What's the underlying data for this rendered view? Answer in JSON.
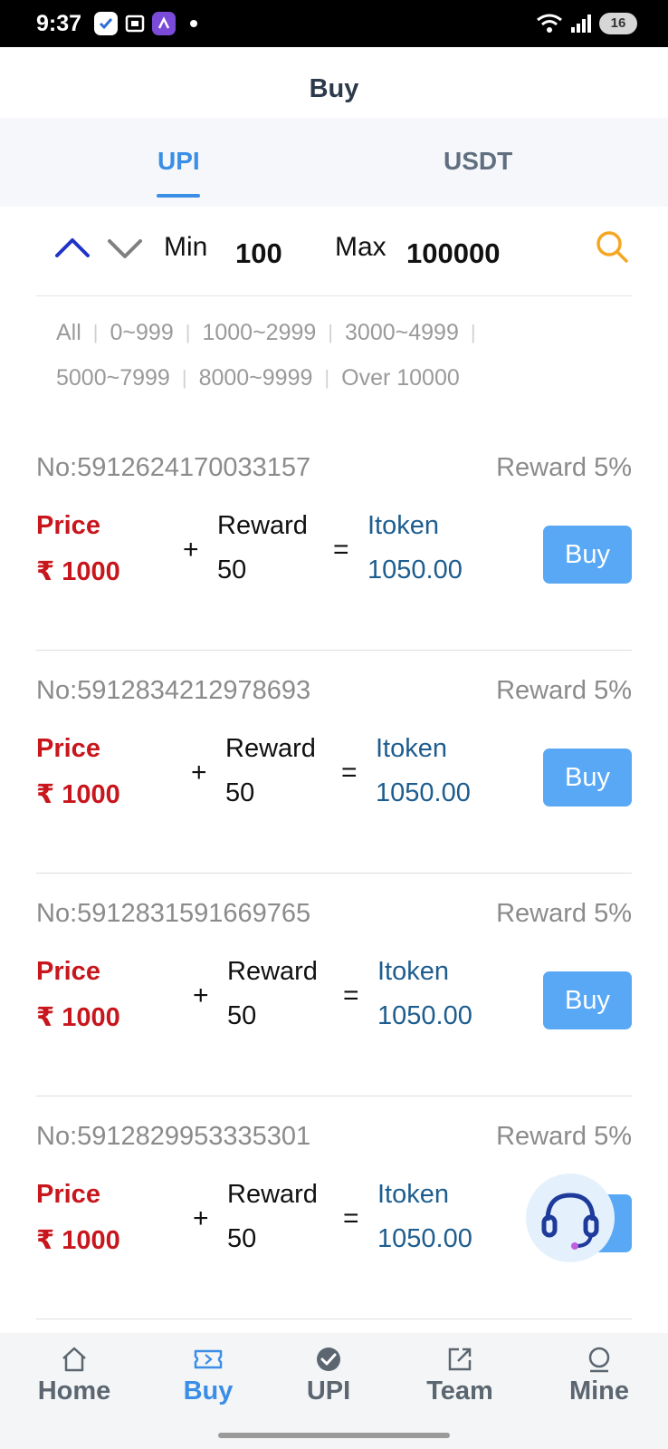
{
  "status_bar": {
    "time": "9:37",
    "battery": "16"
  },
  "header": {
    "title": "Buy"
  },
  "tabs": [
    {
      "label": "UPI",
      "active": true
    },
    {
      "label": "USDT",
      "active": false
    }
  ],
  "filter": {
    "min_label": "Min",
    "min_value": "100",
    "max_label": "Max",
    "max_value": "100000"
  },
  "ranges": [
    "All",
    "0~999",
    "1000~2999",
    "3000~4999",
    "5000~7999",
    "8000~9999",
    "Over 10000"
  ],
  "orders": [
    {
      "no": "No:5912624170033157",
      "reward_pct": "Reward 5%",
      "price_label": "Price",
      "price_value": "₹ 1000",
      "plus": "+",
      "reward_label": "Reward",
      "reward_value": "50",
      "equals": "=",
      "token_label": "Itoken",
      "token_value": "1050.00",
      "buy_label": "Buy"
    },
    {
      "no": "No:5912834212978693",
      "reward_pct": "Reward 5%",
      "price_label": "Price",
      "price_value": "₹ 1000",
      "plus": "+",
      "reward_label": "Reward",
      "reward_value": "50",
      "equals": "=",
      "token_label": "Itoken",
      "token_value": "1050.00",
      "buy_label": "Buy"
    },
    {
      "no": "No:5912831591669765",
      "reward_pct": "Reward 5%",
      "price_label": "Price",
      "price_value": "₹ 1000",
      "plus": "+",
      "reward_label": "Reward",
      "reward_value": "50",
      "equals": "=",
      "token_label": "Itoken",
      "token_value": "1050.00",
      "buy_label": "Buy"
    },
    {
      "no": "No:5912829953335301",
      "reward_pct": "Reward 5%",
      "price_label": "Price",
      "price_value": "₹ 1000",
      "plus": "+",
      "reward_label": "Reward",
      "reward_value": "50",
      "equals": "=",
      "token_label": "Itoken",
      "token_value": "1050.00",
      "buy_label": "Buy"
    }
  ],
  "nav": [
    {
      "label": "Home",
      "icon": "home-icon",
      "active": false
    },
    {
      "label": "Buy",
      "icon": "ticket-icon",
      "active": true
    },
    {
      "label": "UPI",
      "icon": "check-circle-icon",
      "active": false
    },
    {
      "label": "Team",
      "icon": "share-icon",
      "active": false
    },
    {
      "label": "Mine",
      "icon": "user-icon",
      "active": false
    }
  ],
  "colors": {
    "accent": "#3a8ee6",
    "price_red": "#c8161d",
    "token_blue": "#1d5d8f",
    "buy_button": "#58a8f5",
    "search_orange": "#f5a623"
  }
}
